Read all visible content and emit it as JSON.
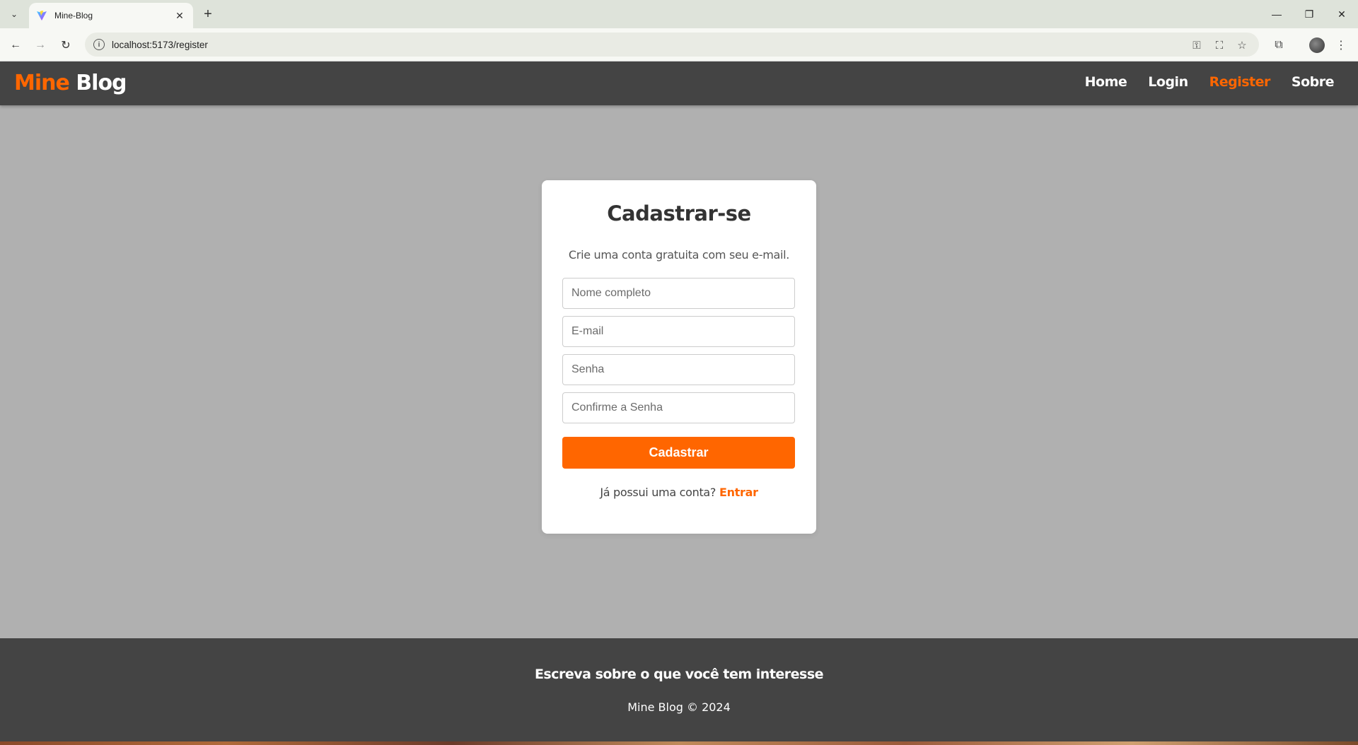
{
  "browser": {
    "tab_title": "Mine-Blog",
    "url": "localhost:5173/register"
  },
  "site": {
    "brand_part1": "Mine",
    "brand_part2": "Blog",
    "nav": [
      {
        "label": "Home"
      },
      {
        "label": "Login"
      },
      {
        "label": "Register",
        "active": true
      },
      {
        "label": "Sobre"
      }
    ]
  },
  "register": {
    "title": "Cadastrar-se",
    "subtitle": "Crie uma conta gratuita com seu e-mail.",
    "fields": {
      "name_placeholder": "Nome completo",
      "email_placeholder": "E-mail",
      "password_placeholder": "Senha",
      "confirm_placeholder": "Confirme a Senha"
    },
    "submit_label": "Cadastrar",
    "login_prompt": "Já possui uma conta?",
    "login_link": "Entrar"
  },
  "footer": {
    "tagline": "Escreva sobre o que você tem interesse",
    "copyright": "Mine Blog © 2024"
  },
  "colors": {
    "accent": "#ff6600",
    "header_bg": "#444444",
    "page_bg": "#b0b0b0"
  }
}
